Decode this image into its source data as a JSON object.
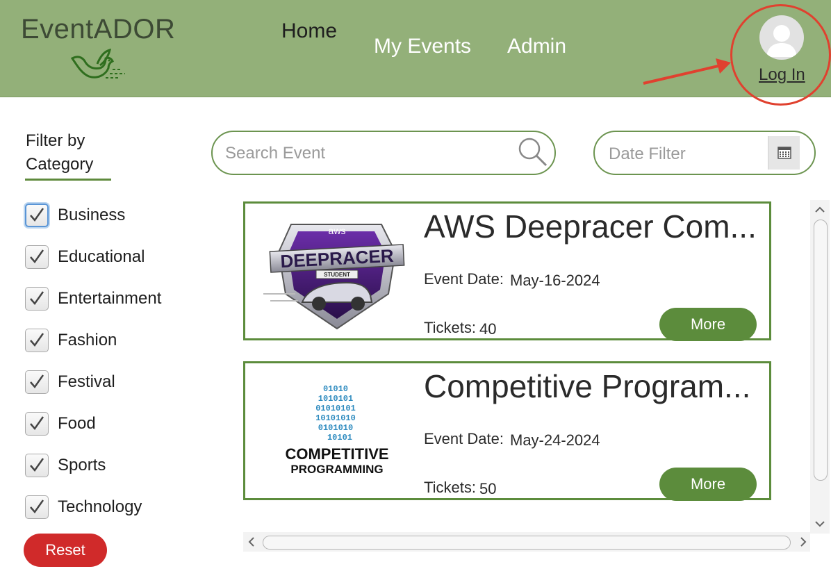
{
  "header": {
    "brand": "EventADOR",
    "nav": {
      "home": "Home",
      "my_events": "My Events",
      "admin": "Admin"
    },
    "login_label": "Log In",
    "colors": {
      "header_bg": "#93b079",
      "annotation": "#e0412f"
    }
  },
  "sidebar": {
    "filter_title_line1": "Filter by",
    "filter_title_line2": "Category",
    "categories": [
      {
        "label": "Business",
        "checked": true
      },
      {
        "label": "Educational",
        "checked": true
      },
      {
        "label": "Entertainment",
        "checked": true
      },
      {
        "label": "Fashion",
        "checked": true
      },
      {
        "label": "Festival",
        "checked": true
      },
      {
        "label": "Food",
        "checked": true
      },
      {
        "label": "Sports",
        "checked": true
      },
      {
        "label": "Technology",
        "checked": true
      }
    ],
    "reset_label": "Reset"
  },
  "search": {
    "placeholder": "Search Event",
    "value": ""
  },
  "date_filter": {
    "placeholder": "Date Filter",
    "value": ""
  },
  "events": [
    {
      "title": "AWS Deepracer Com...",
      "date_label": "Event Date:",
      "date": "May-16-2024",
      "tickets_label": "Tickets:",
      "tickets": "40",
      "more_label": "More",
      "image": "deepracer-student-logo",
      "logo_text": {
        "aws": "aws",
        "main": "DEEPRACER",
        "sub": "STUDENT"
      }
    },
    {
      "title": "Competitive Program...",
      "date_label": "Event Date:",
      "date": "May-24-2024",
      "tickets_label": "Tickets:",
      "tickets": "50",
      "more_label": "More",
      "image": "competitive-programming-logo",
      "logo_text": {
        "line1": "COMPETITIVE",
        "line2": "PROGRAMMING"
      }
    }
  ],
  "icons": [
    "dove-logo-icon",
    "avatar-icon",
    "search-icon",
    "calendar-icon",
    "checkmark-icon",
    "scroll-arrow-icon",
    "annotation-arrow-icon"
  ],
  "theme": {
    "accent": "#5c8c3c",
    "reset": "#d02a2a"
  }
}
